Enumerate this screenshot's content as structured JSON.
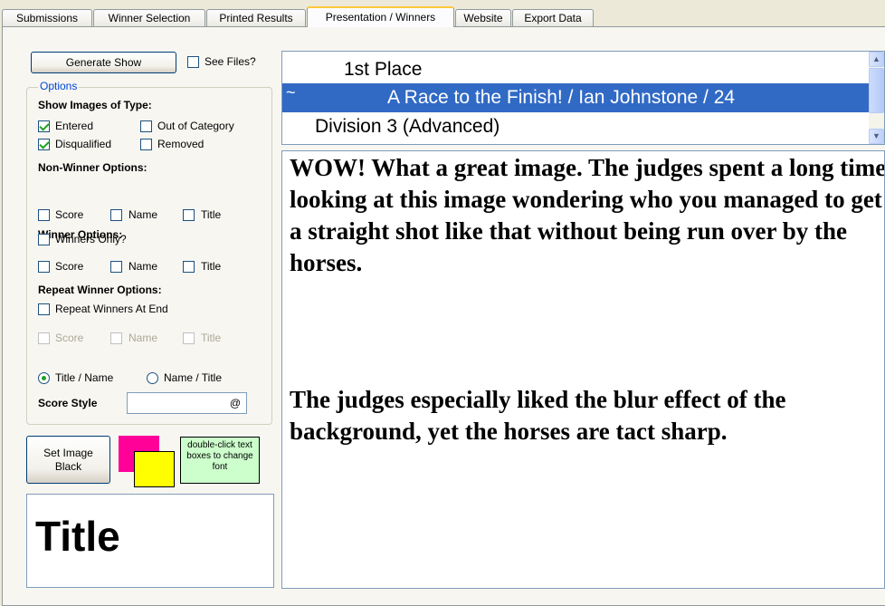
{
  "tabs": [
    "Submissions",
    "Winner Selection",
    "Printed Results",
    "Presentation / Winners",
    "Website",
    "Export Data"
  ],
  "active_tab": "Presentation / Winners",
  "controls": {
    "generate_show": "Generate Show",
    "see_files": "See Files?",
    "see_files_checked": false
  },
  "options": {
    "legend": "Options",
    "show_images_heading": "Show Images of Type:",
    "show_images": [
      {
        "label": "Entered",
        "checked": true
      },
      {
        "label": "Out of Category",
        "checked": false
      },
      {
        "label": "Disqualified",
        "checked": true
      },
      {
        "label": "Removed",
        "checked": false
      }
    ],
    "non_winner_heading": "Non-Winner Options:",
    "non_winner": [
      {
        "label": "Score",
        "checked": false
      },
      {
        "label": "Name",
        "checked": false
      },
      {
        "label": "Title",
        "checked": false
      }
    ],
    "winner_heading": "Winner Options:",
    "winners_only": {
      "label": "Winners Only?",
      "checked": false
    },
    "winner": [
      {
        "label": "Score",
        "checked": false
      },
      {
        "label": "Name",
        "checked": false
      },
      {
        "label": "Title",
        "checked": false
      }
    ],
    "repeat_heading": "Repeat Winner Options:",
    "repeat_at_end": {
      "label": "Repeat Winners At End",
      "checked": false
    },
    "repeat": [
      {
        "label": "Score",
        "checked": false,
        "disabled": true
      },
      {
        "label": "Name",
        "checked": false,
        "disabled": true
      },
      {
        "label": "Title",
        "checked": false,
        "disabled": true
      }
    ],
    "order": [
      {
        "label": "Title / Name",
        "selected": true
      },
      {
        "label": "Name / Title",
        "selected": false
      }
    ],
    "score_style_label": "Score Style",
    "score_style_value": "",
    "score_style_symbol": "@"
  },
  "image_bg_button": "Set Image Black",
  "swatch_colors": {
    "front": "#ff0099",
    "back": "#ffff00"
  },
  "font_hint": "double-click text boxes to change font",
  "title_preview": "Title",
  "list": {
    "rows": [
      {
        "text": "1st Place",
        "selected": false
      },
      {
        "text": "A Race to the Finish! / Ian Johnstone / 24",
        "selected": true,
        "marker": "~"
      },
      {
        "text": "Division 3 (Advanced)",
        "selected": false
      }
    ]
  },
  "comment": [
    "WOW!  What a great image.  The judges spent a long time looking at this image wondering who you managed to get a straight shot like that without being run over by the horses.",
    "The judges especially liked the blur effect of the background, yet the horses are tact sharp."
  ],
  "colors": {
    "selection": "#316ac5",
    "accent_tab": "#ffc83c",
    "legend": "#0046d5"
  }
}
